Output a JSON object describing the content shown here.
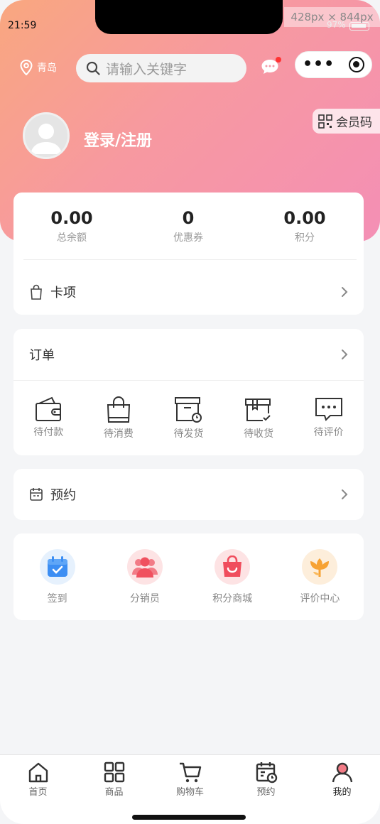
{
  "status": {
    "time": "21:59",
    "battery": "97%"
  },
  "devtools": {
    "dimensions": "428px × 844px"
  },
  "header": {
    "location": "青岛",
    "search_placeholder": "请输入关键字"
  },
  "profile": {
    "login_label": "登录/注册",
    "member_code_label": "会员码"
  },
  "stats": [
    {
      "value": "0.00",
      "label": "总余额"
    },
    {
      "value": "0",
      "label": "优惠券"
    },
    {
      "value": "0.00",
      "label": "积分"
    }
  ],
  "cards_item": {
    "label": "卡项"
  },
  "orders": {
    "title": "订单",
    "items": [
      {
        "label": "待付款",
        "icon": "wallet-icon"
      },
      {
        "label": "待消费",
        "icon": "shopping-bag-icon"
      },
      {
        "label": "待发货",
        "icon": "box-clock-icon"
      },
      {
        "label": "待收货",
        "icon": "box-check-icon"
      },
      {
        "label": "待评价",
        "icon": "comment-icon"
      }
    ]
  },
  "booking": {
    "label": "预约"
  },
  "services": [
    {
      "label": "签到",
      "icon": "calendar-check-icon",
      "color": "#3c8ef3"
    },
    {
      "label": "分销员",
      "icon": "people-icon",
      "color": "#f0515f"
    },
    {
      "label": "积分商城",
      "icon": "store-bag-icon",
      "color": "#f04d5d"
    },
    {
      "label": "评价中心",
      "icon": "tulip-icon",
      "color": "#f7a233"
    }
  ],
  "tabbar": [
    {
      "label": "首页",
      "icon": "home-icon"
    },
    {
      "label": "商品",
      "icon": "grid-icon"
    },
    {
      "label": "购物车",
      "icon": "cart-icon"
    },
    {
      "label": "预约",
      "icon": "calendar-clock-icon"
    },
    {
      "label": "我的",
      "icon": "user-icon",
      "active": true
    }
  ],
  "colors": {
    "hero_start": "#f9a77f",
    "hero_end": "#f48fb5",
    "unread_dot": "#ff3333"
  }
}
